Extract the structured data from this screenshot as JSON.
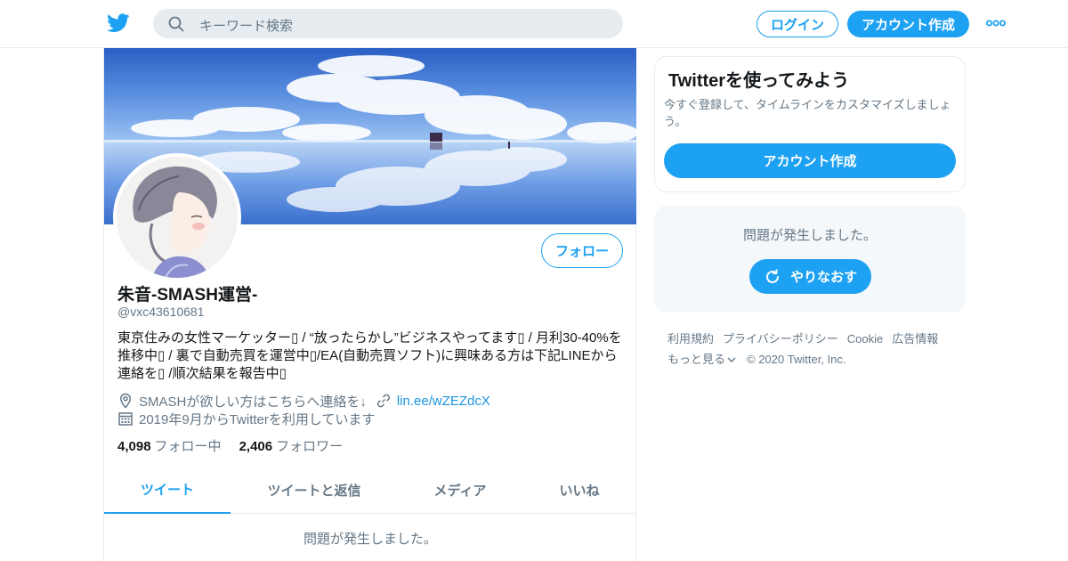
{
  "topbar": {
    "logo": "twitter-bird-icon",
    "search_placeholder": "キーワード検索",
    "login_label": "ログイン",
    "signup_label": "アカウント作成",
    "more_icon": "more-dots-icon"
  },
  "profile": {
    "display_name": "朱音-SMASH運営-",
    "screen_name": "@vxc43610681",
    "follow_label": "フォロー",
    "bio": "東京住みの女性マーケッター▯ / “放ったらかし”ビジネスやってます▯ / 月利30-40%を推移中▯ / 裏で自動売買を運営中▯/EA(自動売買ソフト)に興味ある方は下記LINEから連絡を▯ /順次結果を報告中▯",
    "location": "SMASHが欲しい方はこちらへ連絡を↓",
    "url": "lin.ee/wZEZdcX",
    "joined": "2019年9月からTwitterを利用しています",
    "following_count": "4,098",
    "following_label": "フォロー中",
    "followers_count": "2,406",
    "followers_label": "フォロワー"
  },
  "tabs": [
    {
      "label": "ツイート",
      "active": true
    },
    {
      "label": "ツイートと返信",
      "active": false
    },
    {
      "label": "メディア",
      "active": false
    },
    {
      "label": "いいね",
      "active": false
    }
  ],
  "timeline": {
    "error": "問題が発生しました。"
  },
  "sidebar": {
    "signup_title": "Twitterを使ってみよう",
    "signup_desc": "今すぐ登録して、タイムラインをカスタマイズしましょう。",
    "signup_button": "アカウント作成",
    "error_text": "問題が発生しました。",
    "retry_label": "やりなおす"
  },
  "footer": {
    "terms": "利用規約",
    "privacy": "プライバシーポリシー",
    "cookie": "Cookie",
    "ads": "広告情報",
    "more": "もっと見る",
    "copyright": "© 2020 Twitter, Inc."
  },
  "colors": {
    "accent": "#1da1f2",
    "link": "#1b95e0",
    "muted": "#657786",
    "border": "#e6ecf0"
  }
}
